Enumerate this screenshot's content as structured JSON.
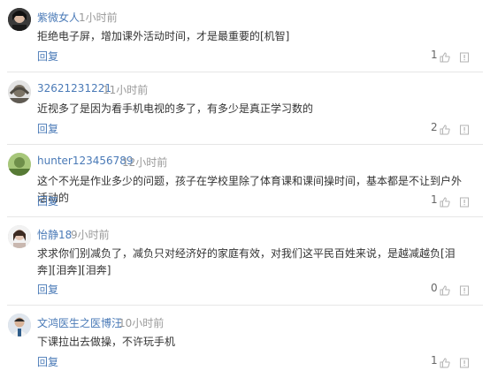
{
  "ui": {
    "reply_label": "回复"
  },
  "comments": [
    {
      "name": "紫微女人",
      "time": "1小时前",
      "text": "拒绝电子屏，增加课外活动时间，才是最重要的[机智]",
      "likes": "1"
    },
    {
      "name": "32621231221",
      "time": "11小时前",
      "text": "近视多了是因为看手机电视的多了，有多少是真正学习数的",
      "likes": "2"
    },
    {
      "name": "hunter123456789",
      "time": "12小时前",
      "text": "这个不光是作业多少的问题，孩子在学校里除了体育课和课间操时间，基本都是不让到户外活动的",
      "likes": "1"
    },
    {
      "name": "怡静18",
      "time": "9小时前",
      "text": "求求你们别减负了，减负只对经济好的家庭有效，对我们这平民百姓来说，是越减越负[泪奔][泪奔][泪奔]",
      "likes": "0"
    },
    {
      "name": "文鸿医生之医博汪",
      "time": "10小时前",
      "text": "下课拉出去做操，不许玩手机",
      "likes": "1"
    }
  ]
}
